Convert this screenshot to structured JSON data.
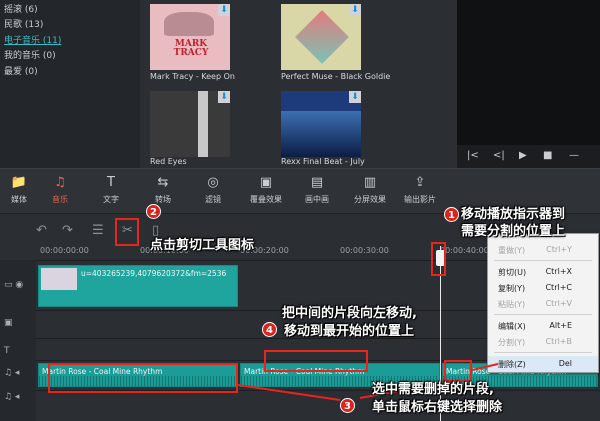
{
  "sidebar": {
    "items": [
      {
        "label": "摇滚 (6)",
        "active": false
      },
      {
        "label": "民歌 (13)",
        "active": false
      },
      {
        "label": "电子音乐 (11)",
        "active": true
      },
      {
        "label": "我的音乐 (0)",
        "active": false
      },
      {
        "label": "最爱 (0)",
        "active": false
      }
    ]
  },
  "library": {
    "items": [
      {
        "title": "Mark Tracy - Keep On",
        "art_text": "MARK TRACY",
        "art_color": "#e8bcc0"
      },
      {
        "title": "Perfect Muse - Black Goldie",
        "art_text": "",
        "art_color": "#d9d6a8"
      },
      {
        "title": "Red Eyes",
        "art_text": "",
        "art_color": "#3a3a3a"
      },
      {
        "title": "Rexx Final Beat - July",
        "art_text": "",
        "art_color": "#1d3b7a"
      }
    ],
    "download_icon": "download-arrow-icon"
  },
  "preview": {
    "controls": [
      "|<",
      "<|",
      "▶",
      "■",
      "—"
    ]
  },
  "toolbar": {
    "items": [
      {
        "label": "媒体",
        "icon": "📁"
      },
      {
        "label": "音乐",
        "icon": "♫"
      },
      {
        "label": "文字",
        "icon": "T"
      },
      {
        "label": "转场",
        "icon": "⇆"
      },
      {
        "label": "滤镜",
        "icon": "◎"
      },
      {
        "label": "覆叠效果",
        "icon": "▣"
      },
      {
        "label": "画中画",
        "icon": "▤"
      },
      {
        "label": "分屏效果",
        "icon": "▥"
      },
      {
        "label": "输出影片",
        "icon": "⇪"
      }
    ],
    "active_index": 1
  },
  "edit_row": {
    "undo": "↶",
    "redo": "↷",
    "adjust": "☰",
    "cut": "✂",
    "delete": "▯"
  },
  "ruler": {
    "timecodes": [
      "00:00:00:00",
      "00:00:10:00",
      "00:00:20:00",
      "00:00:30:00",
      "00:00:40:00"
    ]
  },
  "timeline": {
    "video_clip": "u=403265239,4079620372&fm=2536",
    "audio_clip_1": "Martin Rose - Coal Mine Rhythm",
    "audio_clip_2": "Martin Rose - Coal Mine Rhythm",
    "audio_clip_3": "Martin Rose - Coal Mine Rhythm"
  },
  "context_menu": {
    "items": [
      {
        "label": "重做(Y)",
        "shortcut": "Ctrl+Y",
        "disabled": true
      },
      {
        "label": "剪切(U)",
        "shortcut": "Ctrl+X",
        "disabled": false
      },
      {
        "label": "复制(Y)",
        "shortcut": "Ctrl+C",
        "disabled": false
      },
      {
        "label": "粘贴(Y)",
        "shortcut": "Ctrl+V",
        "disabled": true
      },
      {
        "label": "编辑(X)",
        "shortcut": "Alt+E",
        "disabled": false
      },
      {
        "label": "分割(Y)",
        "shortcut": "Ctrl+B",
        "disabled": true
      },
      {
        "label": "删除(Z)",
        "shortcut": "Del",
        "disabled": false
      }
    ]
  },
  "annotations": {
    "step1_line1": "移动播放指示器到",
    "step1_line2": "需要分割的位置上",
    "step2": "点击剪切工具图标",
    "step3_line1": "选中需要删掉的片段,",
    "step3_line2": "单击鼠标右键选择删除",
    "step4_line1": "把中间的片段向左移动,",
    "step4_line2": "移动到最开始的位置上",
    "badge1": "1",
    "badge2": "2",
    "badge3": "3",
    "badge4": "4"
  },
  "colors": {
    "accent": "#e7674f",
    "clip": "#1fa49e",
    "annotation_red": "#e8251d"
  }
}
